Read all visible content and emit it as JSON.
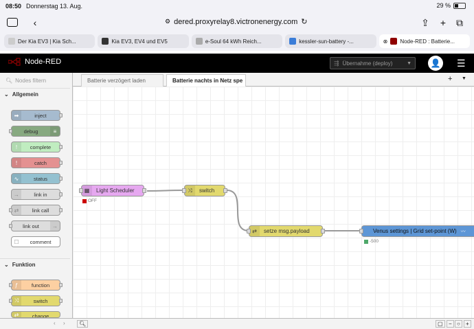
{
  "status_bar": {
    "time": "08:50",
    "date": "Donnerstag 13. Aug.",
    "battery": "29 %"
  },
  "browser": {
    "url": "dered.proxyrelay8.victronenergy.com",
    "tabs": [
      {
        "label": "Der Kia EV3 | Kia Sch...",
        "color": "#ccc"
      },
      {
        "label": "Kia EV3, EV4 und EV5",
        "color": "#333"
      },
      {
        "label": "e-Soul 64 kWh Reich...",
        "color": "#aaa"
      },
      {
        "label": "kessler-sun-battery -...",
        "color": "#3b7dd8"
      },
      {
        "label": "Node-RED : Batterie...",
        "color": "#8f0000"
      }
    ]
  },
  "nodered": {
    "title": "Node-RED",
    "deploy_label": "Übernahme (deploy)",
    "filter_placeholder": "Nodes filtern",
    "categories": [
      {
        "label": "Allgemein"
      },
      {
        "label": "Funktion"
      }
    ],
    "palette": [
      {
        "label": "inject",
        "color": "#a6bbcf",
        "icon": "➡"
      },
      {
        "label": "debug",
        "color": "#87a980",
        "icon": "≡"
      },
      {
        "label": "complete",
        "color": "#c0edc0",
        "icon": "!"
      },
      {
        "label": "catch",
        "color": "#e49191",
        "icon": "!"
      },
      {
        "label": "status",
        "color": "#94c1d0",
        "icon": "∿"
      },
      {
        "label": "link in",
        "color": "#dddddd",
        "icon": "→"
      },
      {
        "label": "link call",
        "color": "#dddddd",
        "icon": "⇄"
      },
      {
        "label": "link out",
        "color": "#dddddd",
        "icon": "→"
      },
      {
        "label": "comment",
        "color": "#ffffff",
        "icon": ""
      },
      {
        "label": "function",
        "color": "#fdd0a2",
        "icon": "ƒ"
      },
      {
        "label": "switch",
        "color": "#e2d96e",
        "icon": "⤨"
      },
      {
        "label": "change",
        "color": "#e2d96e",
        "icon": "⇄"
      }
    ],
    "workspace_tabs": [
      {
        "label": "Batterie verzögert laden"
      },
      {
        "label": "Batterie nachts in Netz spe"
      }
    ],
    "flow_nodes": [
      {
        "label": "Light Scheduler",
        "color": "#e6a8f0",
        "status": "OFF",
        "status_color": "#cc0000"
      },
      {
        "label": "switch",
        "color": "#e2d96e"
      },
      {
        "label": "setze msg.payload",
        "color": "#e2d96e"
      },
      {
        "label": "Venus settings | Grid set-point (W)",
        "color": "#5d96d6",
        "status": "-500",
        "status_color": "#4fa86a"
      }
    ]
  }
}
